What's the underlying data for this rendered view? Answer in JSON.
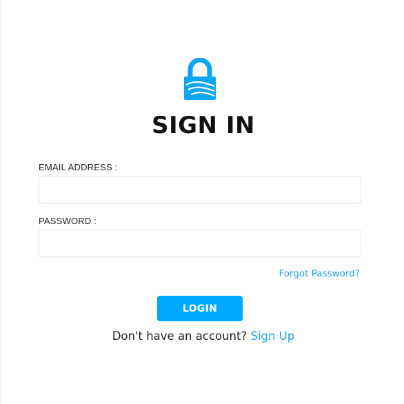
{
  "header": {
    "logo_icon": "padlock-icon",
    "title": "SIGN IN"
  },
  "form": {
    "email": {
      "label": "EMAIL ADDRESS :",
      "value": "",
      "placeholder": ""
    },
    "password": {
      "label": "PASSWORD :",
      "value": "",
      "placeholder": ""
    },
    "forgot_password_label": "Forgot Password?",
    "login_label": "LOGIN"
  },
  "footer": {
    "prompt": "Don't have an account?",
    "signup_label": "Sign Up"
  },
  "colors": {
    "accent": "#00a8ff",
    "link": "#1da1f2",
    "text": "#111111"
  }
}
